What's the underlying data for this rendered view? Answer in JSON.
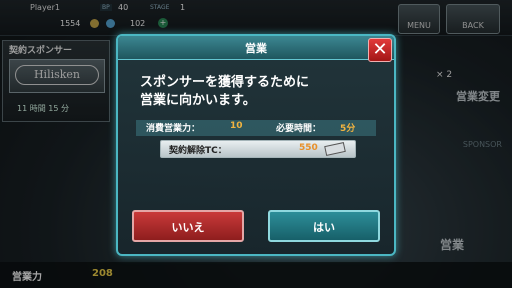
{
  "hud": {
    "player": "Player1",
    "bp_label": "BP",
    "bp_value": "40",
    "stage_label": "STAGE",
    "stage_value": "1",
    "coins": "1554",
    "gems": "102",
    "plus": "+",
    "menu_label": "MENU",
    "back_label": "BACK"
  },
  "sponsor_panel": {
    "title": "契約スポンサー",
    "logo": "Hilisken",
    "time_left": "11 時間 15 分"
  },
  "right_panel": {
    "count": "× 2",
    "change": "営業変更",
    "sponsor_text": "SPONSOR",
    "sales": "営業"
  },
  "bottom": {
    "sales_power_label": "営業力",
    "sales_power_value": "208"
  },
  "dialog": {
    "title": "営業",
    "close": "✕",
    "message_line1": "スポンサーを獲得するために",
    "message_line2": "営業に向かいます。",
    "cost_label": "消費営業力：",
    "cost_value": "10",
    "time_label": "必要時間：",
    "time_value": "5分",
    "tc_label": "契約解除TC：",
    "tc_value": "550",
    "no_label": "いいえ",
    "yes_label": "はい"
  },
  "colors": {
    "accent": "#4bb7c3",
    "cost": "#f2b440",
    "no_button": "#c93a3a",
    "yes_button": "#2d8e99"
  }
}
